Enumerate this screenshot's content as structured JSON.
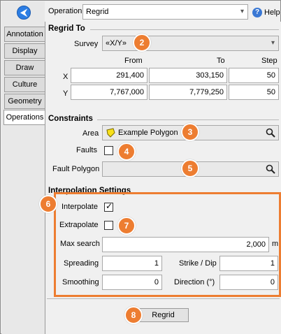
{
  "header": {
    "operation_label": "Operation",
    "operation_value": "Regrid",
    "help_label": "Help"
  },
  "tabs": [
    {
      "label": "Annotation"
    },
    {
      "label": "Display"
    },
    {
      "label": "Draw"
    },
    {
      "label": "Culture"
    },
    {
      "label": "Geometry"
    },
    {
      "label": "Operations"
    }
  ],
  "regrid_to": {
    "title": "Regrid To",
    "survey_label": "Survey",
    "survey_value": "«X/Y»",
    "col_from": "From",
    "col_to": "To",
    "col_step": "Step",
    "x_label": "X",
    "x_from": "291,400",
    "x_to": "303,150",
    "x_step": "50",
    "y_label": "Y",
    "y_from": "7,767,000",
    "y_to": "7,779,250",
    "y_step": "50"
  },
  "constraints": {
    "title": "Constraints",
    "area_label": "Area",
    "area_value": "Example Polygon",
    "faults_label": "Faults",
    "fault_polygon_label": "Fault Polygon",
    "fault_polygon_value": ""
  },
  "interpolation": {
    "title": "Interpolation Settings",
    "interpolate_label": "Interpolate",
    "interpolate_checked": true,
    "extrapolate_label": "Extrapolate",
    "extrapolate_checked": false,
    "max_search_label": "Max search",
    "max_search_value": "2,000",
    "max_search_unit": "m",
    "spreading_label": "Spreading",
    "spreading_value": "1",
    "strike_dip_label": "Strike / Dip",
    "strike_dip_value": "1",
    "smoothing_label": "Smoothing",
    "smoothing_value": "0",
    "direction_label": "Direction (°)",
    "direction_value": "0"
  },
  "actions": {
    "regrid_button": "Regrid"
  },
  "callouts": [
    "2",
    "3",
    "4",
    "5",
    "6",
    "7",
    "8"
  ],
  "colors": {
    "callout": "#ed7d31",
    "accent": "#2c7de3"
  }
}
